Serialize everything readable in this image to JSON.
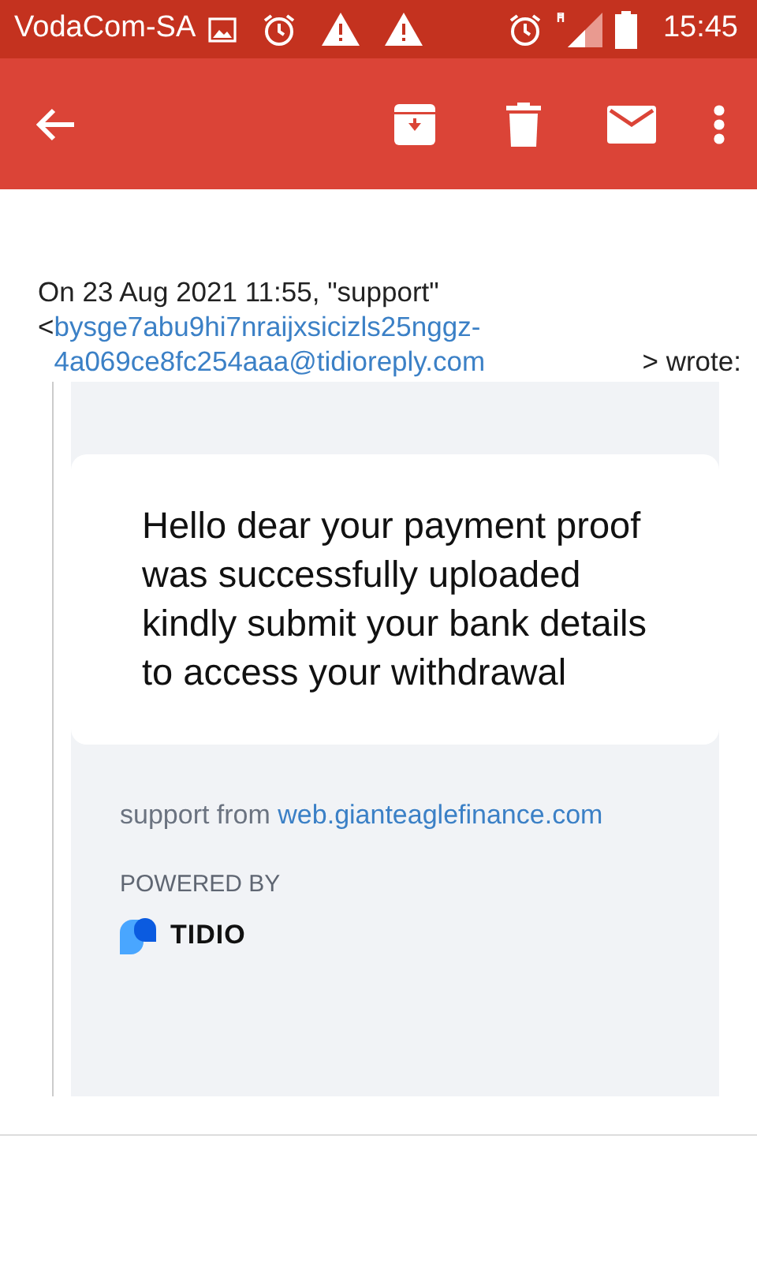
{
  "status_bar": {
    "carrier": "VodaCom-SA",
    "time": "15:45"
  },
  "toolbar": {
    "actions": [
      {
        "kind": "archive"
      },
      {
        "kind": "delete"
      },
      {
        "kind": "mail"
      },
      {
        "kind": "more"
      }
    ]
  },
  "attribution": {
    "line": "On 23 Aug 2021 11:55, \"support\"",
    "open_bracket": "<",
    "email": "bysge7abu9hi7nraijxsicizls25nggz-4a069ce8fc254aaa@tidioreply.com",
    "suffix": "> wrote:"
  },
  "message": {
    "text": "Hello dear your payment proof was successfully uploaded kindly submit your bank details to access your withdrawal",
    "sender_prefix": "support from",
    "sender_link": "web.gianteaglefinance.com",
    "powered_by": "POWERED BY",
    "brand": "TIDIO"
  }
}
